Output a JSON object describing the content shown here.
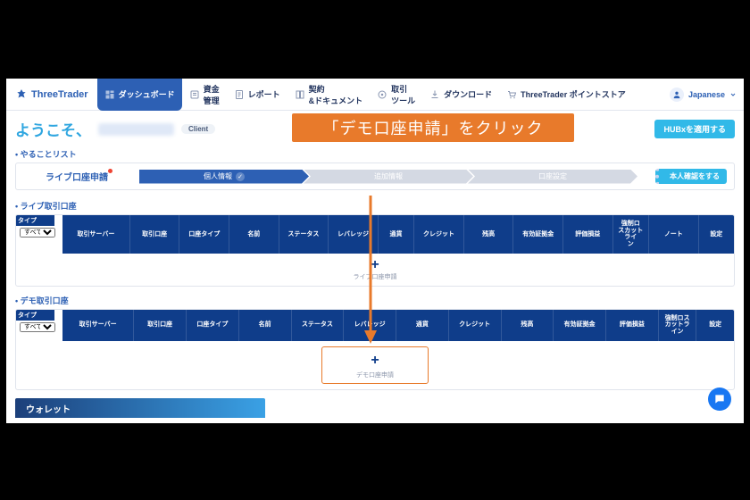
{
  "brand": "ThreeTrader",
  "nav": {
    "dashboard": "ダッシュボード",
    "funds": "資金\n管理",
    "report": "レポート",
    "contracts": "契約\n&ドキュメント",
    "tools": "取引\nツール",
    "download": "ダウンロード",
    "points": "ThreeTrader ポイントストア"
  },
  "lang": {
    "label": "Japanese"
  },
  "greeting": {
    "text": "ようこそ、",
    "badge": "Client"
  },
  "hubx_btn": "HUBxを適用する",
  "sections": {
    "todo": "やることリスト",
    "live": "ライブ取引口座",
    "demo": "デモ取引口座"
  },
  "todo": {
    "title": "ライブ口座申請",
    "steps": [
      "個人情報",
      "追加情報",
      "口座設定"
    ],
    "verify_btn": "本人確認をする"
  },
  "filter": {
    "label": "タイプ",
    "value": "すべて"
  },
  "live_cols": [
    "取引サーバー",
    "取引口座",
    "口座タイプ",
    "名前",
    "ステータス",
    "レバレッジ",
    "通貨",
    "クレジット",
    "残高",
    "有効証拠金",
    "評価損益",
    "強制ロ\nスカット\nライ\nン",
    "ノート",
    "設定"
  ],
  "demo_cols": [
    "取引サーバー",
    "取引口座",
    "口座タイプ",
    "名前",
    "ステータス",
    "レバレッジ",
    "通貨",
    "クレジット",
    "残高",
    "有効証拠金",
    "評価損益",
    "強制ロス\nカットラ\nイン",
    "設定"
  ],
  "addrow": {
    "live": "ライブ口座申請",
    "demo": "デモ口座申請"
  },
  "wallet": "ウォレット",
  "callout": "「デモ口座申請」をクリック"
}
